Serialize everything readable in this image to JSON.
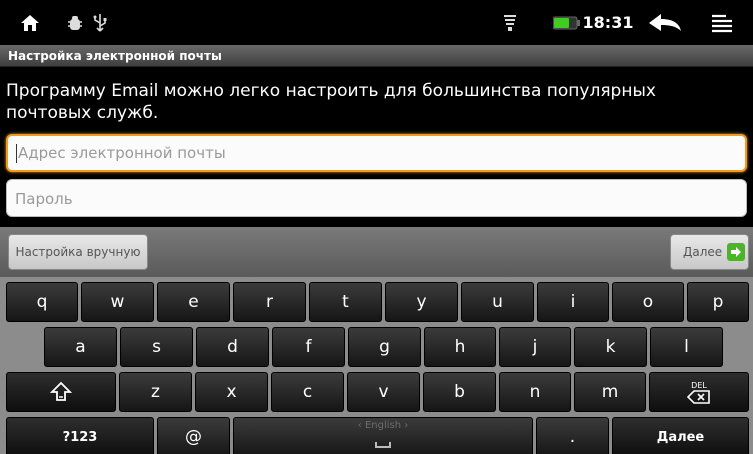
{
  "status_bar": {
    "time": "18:31",
    "icons": [
      "home-icon",
      "bug-icon",
      "usb-icon",
      "wifi-icon",
      "battery-icon",
      "back-icon",
      "menu-icon"
    ]
  },
  "screen": {
    "title": "Настройка электронной почты",
    "intro": "Программу Email можно легко настроить для большинства популярных почтовых служб.",
    "email_placeholder": "Адрес электронной почты",
    "password_placeholder": "Пароль"
  },
  "buttons": {
    "manual_setup": "Настройка вручную",
    "next": "Далее"
  },
  "keyboard": {
    "row1": [
      "q",
      "w",
      "e",
      "r",
      "t",
      "y",
      "u",
      "i",
      "o",
      "p"
    ],
    "row2": [
      "a",
      "s",
      "d",
      "f",
      "g",
      "h",
      "j",
      "k",
      "l"
    ],
    "row3": [
      "z",
      "x",
      "c",
      "v",
      "b",
      "n",
      "m"
    ],
    "shift_icon": "shift-icon",
    "delete_label": "DEL",
    "symbols": "?123",
    "at": "@",
    "space_language": "‹ English ›",
    "period": ".",
    "enter": "Далее"
  },
  "colors": {
    "focus_orange": "#f29a1f",
    "next_green": "#4db32a",
    "battery_green": "#3ecf1e"
  }
}
